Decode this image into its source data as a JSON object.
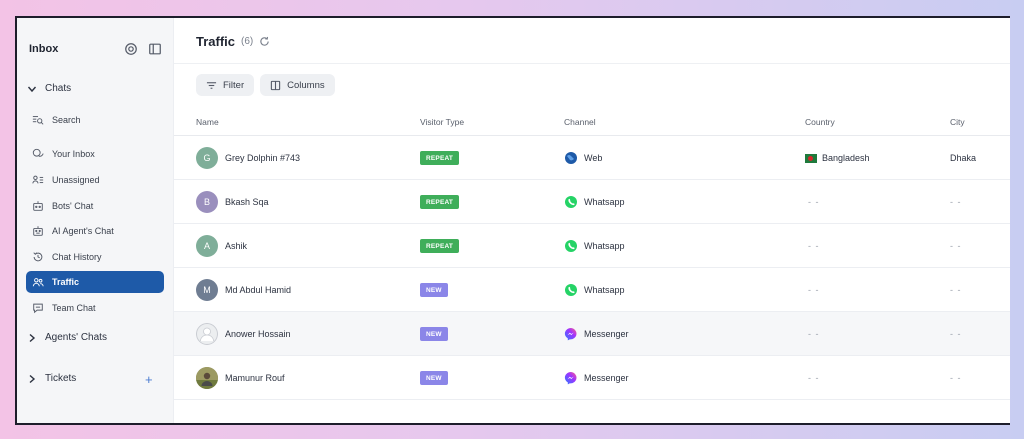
{
  "sidebar": {
    "title": "Inbox",
    "chats_section": "Chats",
    "items": [
      {
        "label": "Search",
        "icon": "search-list-icon"
      },
      {
        "label": "Your Inbox",
        "icon": "chat-bubbles-icon"
      },
      {
        "label": "Unassigned",
        "icon": "person-list-icon"
      },
      {
        "label": "Bots' Chat",
        "icon": "bot-icon"
      },
      {
        "label": "AI Agent's Chat",
        "icon": "ai-bot-icon"
      },
      {
        "label": "Chat History",
        "icon": "history-icon"
      },
      {
        "label": "Traffic",
        "icon": "users-icon",
        "active": true
      },
      {
        "label": "Team Chat",
        "icon": "message-icon"
      }
    ],
    "agents_section": "Agents' Chats",
    "tickets_section": "Tickets"
  },
  "header": {
    "title": "Traffic",
    "count": "(6)"
  },
  "toolbar": {
    "filter_label": "Filter",
    "columns_label": "Columns"
  },
  "table": {
    "columns": [
      "Name",
      "Visitor Type",
      "Channel",
      "Country",
      "City"
    ],
    "rows": [
      {
        "initial": "G",
        "avatar_color": "#7fae99",
        "name": "Grey Dolphin #743",
        "visitor_type": "REPEAT",
        "channel": "Web",
        "channel_icon": "globe-icon",
        "country": "Bangladesh",
        "city": "Dhaka"
      },
      {
        "initial": "B",
        "avatar_color": "#9a8fbd",
        "name": "Bkash Sqa",
        "visitor_type": "REPEAT",
        "channel": "Whatsapp",
        "channel_icon": "whatsapp-icon",
        "country": "- -",
        "city": "- -"
      },
      {
        "initial": "A",
        "avatar_color": "#7fae99",
        "name": "Ashik",
        "visitor_type": "REPEAT",
        "channel": "Whatsapp",
        "channel_icon": "whatsapp-icon",
        "country": "- -",
        "city": "- -"
      },
      {
        "initial": "M",
        "avatar_color": "#6f7d92",
        "name": "Md Abdul Hamid",
        "visitor_type": "NEW",
        "channel": "Whatsapp",
        "channel_icon": "whatsapp-icon",
        "country": "- -",
        "city": "- -"
      },
      {
        "initial": "",
        "avatar_color": "#d7dade",
        "name": "Anower Hossain",
        "visitor_type": "NEW",
        "channel": "Messenger",
        "channel_icon": "messenger-icon",
        "country": "- -",
        "city": "- -"
      },
      {
        "initial": "",
        "avatar_color": "#8a8a5a",
        "name": "Mamunur Rouf",
        "visitor_type": "NEW",
        "channel": "Messenger",
        "channel_icon": "messenger-icon",
        "country": "- -",
        "city": "- -"
      }
    ]
  },
  "colors": {
    "accent": "#1e5aa8",
    "repeat_badge": "#3fae5a",
    "new_badge": "#8b86e8",
    "whatsapp": "#25d366",
    "messenger": "#a050f0",
    "web": "#1e5aa8"
  }
}
